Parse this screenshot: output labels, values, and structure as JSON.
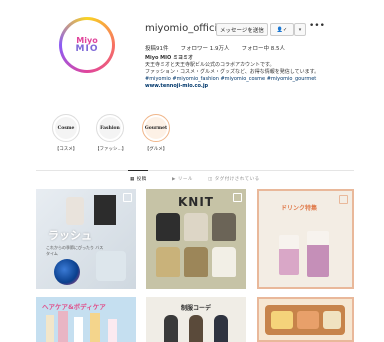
{
  "profile": {
    "username": "miyomio_official",
    "message_label": "メッセージを送信",
    "follow_label": "✓",
    "stats": {
      "posts": "投稿91件",
      "followers": "フォロワー 1.9万人",
      "following": "フォロー中 8.5人"
    },
    "bio": {
      "name": "Miyo MIO ミヨミオ",
      "line1": "天王寺ミオと天王寺駅ビル公式のコラボアカウントです。",
      "line2": "ファッション・コスメ・グルメ・グッズなど、お得な情報を発信しています。",
      "tags": "#miyomio #miyomio_fashion #miyomio_cosme #miyomio_gourmet",
      "link": "www.tennoji-mio.co.jp"
    },
    "logo": {
      "line1": "Miyo",
      "line2": "MIO"
    }
  },
  "highlights": [
    {
      "title": "Cosme",
      "label": "【コスメ】"
    },
    {
      "title": "Fashion",
      "label": "【ファッシ...】"
    },
    {
      "title": "Gourmet",
      "label": "【グルメ】"
    }
  ],
  "tabs": [
    {
      "label": "投稿",
      "active": true
    },
    {
      "label": "リール",
      "active": false
    },
    {
      "label": "タグ付けされている",
      "active": false
    }
  ],
  "posts": [
    {
      "title": "ラッシュ",
      "subtitle": "これからの季節にぴったり バスタイム"
    },
    {
      "title": "KNIT"
    },
    {
      "title": "ドリンク特集"
    },
    {
      "title": "ヘアケア&ボディケア"
    },
    {
      "title": "制服コーデ"
    },
    {
      "title": ""
    }
  ],
  "colors": {
    "accent": "#e0459b",
    "link": "#00376b",
    "border": "#e9b89a"
  }
}
